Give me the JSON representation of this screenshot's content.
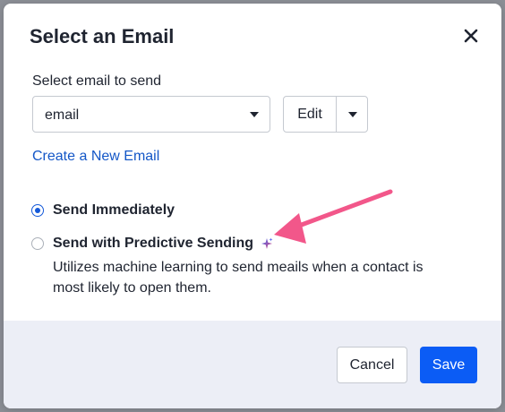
{
  "dialog": {
    "title": "Select an Email",
    "close_icon": "close-icon"
  },
  "email_select": {
    "label": "Select email to send",
    "value": "email",
    "caret_icon": "chevron-down-icon"
  },
  "edit_button": {
    "label": "Edit",
    "caret_icon": "chevron-down-icon"
  },
  "create_link": {
    "label": "Create a New Email"
  },
  "send_options": [
    {
      "label": "Send Immediately",
      "selected": true
    },
    {
      "label": "Send with Predictive Sending",
      "selected": false,
      "icon": "sparkle-icon",
      "description": "Utilizes machine learning to send meails when a contact is most likely to open them."
    }
  ],
  "annotation": {
    "icon": "arrow-icon",
    "color": "#f2578a"
  },
  "footer": {
    "cancel_label": "Cancel",
    "save_label": "Save"
  },
  "colors": {
    "accent": "#0b5cf5",
    "link": "#1457c7",
    "footer_bg": "#eceef6"
  }
}
